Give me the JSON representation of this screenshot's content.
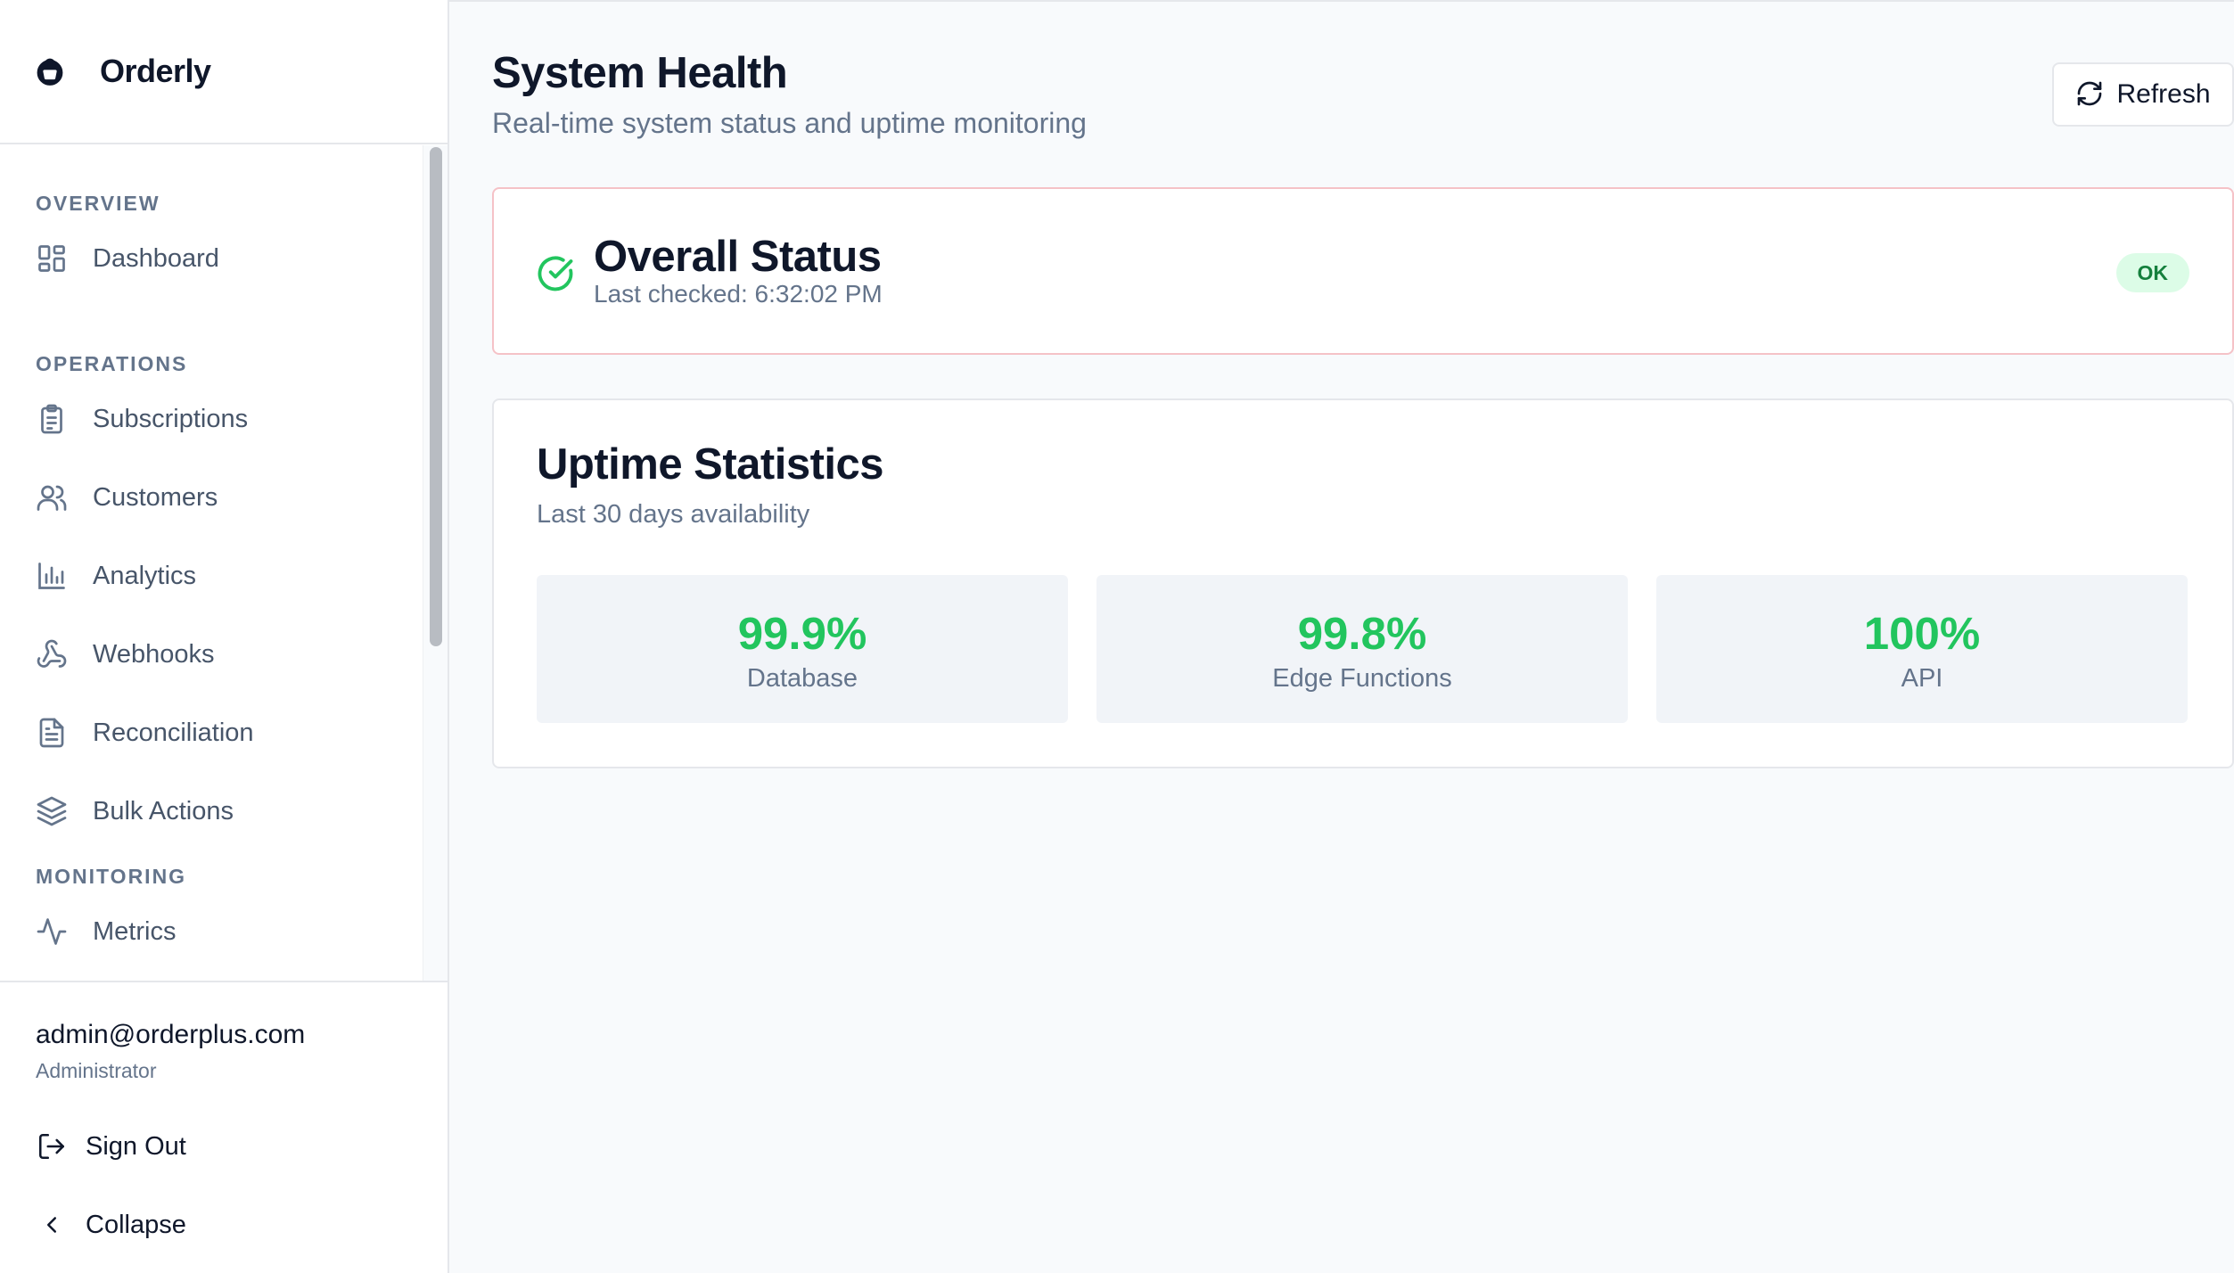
{
  "app": {
    "name": "Orderly",
    "logo_icon": "shopping-bag-icon"
  },
  "sidebar": {
    "sections": [
      {
        "label": "OVERVIEW",
        "items": [
          {
            "label": "Dashboard",
            "icon": "dashboard-icon"
          }
        ]
      },
      {
        "label": "OPERATIONS",
        "items": [
          {
            "label": "Subscriptions",
            "icon": "clipboard-list-icon"
          },
          {
            "label": "Customers",
            "icon": "users-icon"
          },
          {
            "label": "Analytics",
            "icon": "bar-chart-icon"
          },
          {
            "label": "Webhooks",
            "icon": "webhook-icon"
          },
          {
            "label": "Reconciliation",
            "icon": "file-text-icon"
          },
          {
            "label": "Bulk Actions",
            "icon": "layers-icon"
          }
        ]
      },
      {
        "label": "MONITORING",
        "items": [
          {
            "label": "Metrics",
            "icon": "activity-icon"
          }
        ]
      }
    ],
    "user": {
      "email": "admin@orderplus.com",
      "role": "Administrator"
    },
    "sign_out_label": "Sign Out",
    "collapse_label": "Collapse"
  },
  "header": {
    "title": "System Health",
    "subtitle": "Real-time system status and uptime monitoring",
    "refresh_label": "Refresh"
  },
  "overall_status": {
    "title": "Overall Status",
    "last_checked": "Last checked: 6:32:02 PM",
    "badge": "OK",
    "badge_color": "#15803d",
    "card_border_color": "#f5c2c7"
  },
  "uptime": {
    "title": "Uptime Statistics",
    "subtitle": "Last 30 days availability",
    "stats": [
      {
        "value": "99.9%",
        "label": "Database"
      },
      {
        "value": "99.8%",
        "label": "Edge Functions"
      },
      {
        "value": "100%",
        "label": "API"
      }
    ],
    "value_color": "#22c55e"
  }
}
